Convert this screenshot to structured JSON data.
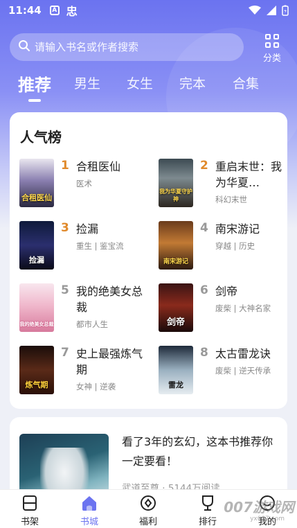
{
  "status_bar": {
    "time": "11:44",
    "app_icon_a": "A",
    "app_icon_b": "忠"
  },
  "search": {
    "placeholder": "请输入书名或作者搜索",
    "category_label": "分类"
  },
  "tabs": [
    {
      "label": "推荐",
      "active": true
    },
    {
      "label": "男生",
      "active": false
    },
    {
      "label": "女生",
      "active": false
    },
    {
      "label": "完本",
      "active": false
    },
    {
      "label": "合集",
      "active": false
    }
  ],
  "ranking": {
    "title": "人气榜",
    "items": [
      {
        "rank": "1",
        "name": "合租医仙",
        "tags": "医术",
        "cover_text": "合租医仙",
        "rank_color": "#e08a2c"
      },
      {
        "rank": "2",
        "name": "重启末世：我为华夏…",
        "tags": "科幻末世",
        "cover_text": "我为华夏守护神",
        "rank_color": "#e08a2c"
      },
      {
        "rank": "3",
        "name": "捡漏",
        "tags": "重生 | 鉴宝流",
        "cover_text": "捡漏",
        "rank_color": "#e08a2c"
      },
      {
        "rank": "4",
        "name": "南宋游记",
        "tags": "穿越 | 历史",
        "cover_text": "南宋游记",
        "rank_color": "#999999"
      },
      {
        "rank": "5",
        "name": "我的绝美女总裁",
        "tags": "都市人生",
        "cover_text": "我的绝美女总裁",
        "rank_color": "#999999"
      },
      {
        "rank": "6",
        "name": "剑帝",
        "tags": "废柴 | 大神名家",
        "cover_text": "剑帝",
        "rank_color": "#999999"
      },
      {
        "rank": "7",
        "name": "史上最强炼气期",
        "tags": "女神 | 逆袭",
        "cover_text": "炼气期",
        "rank_color": "#999999"
      },
      {
        "rank": "8",
        "name": "太古雷龙诀",
        "tags": "废柴 | 逆天传承",
        "cover_text": "雷龙",
        "rank_color": "#999999"
      }
    ]
  },
  "recommendation": {
    "title": "看了3年的玄幻，这本书推荐你一定要看！",
    "meta": "武道至尊 · 5144万阅读"
  },
  "bottom_nav": [
    {
      "label": "书架",
      "active": false
    },
    {
      "label": "书城",
      "active": true
    },
    {
      "label": "福利",
      "active": false
    },
    {
      "label": "排行",
      "active": false
    },
    {
      "label": "我的",
      "active": false
    }
  ],
  "watermark": {
    "main": "007游戏网",
    "sub": "yx007.com"
  },
  "colors": {
    "accent": "#6b73f0",
    "rank_top": "#e08a2c",
    "rank_other": "#999999"
  }
}
